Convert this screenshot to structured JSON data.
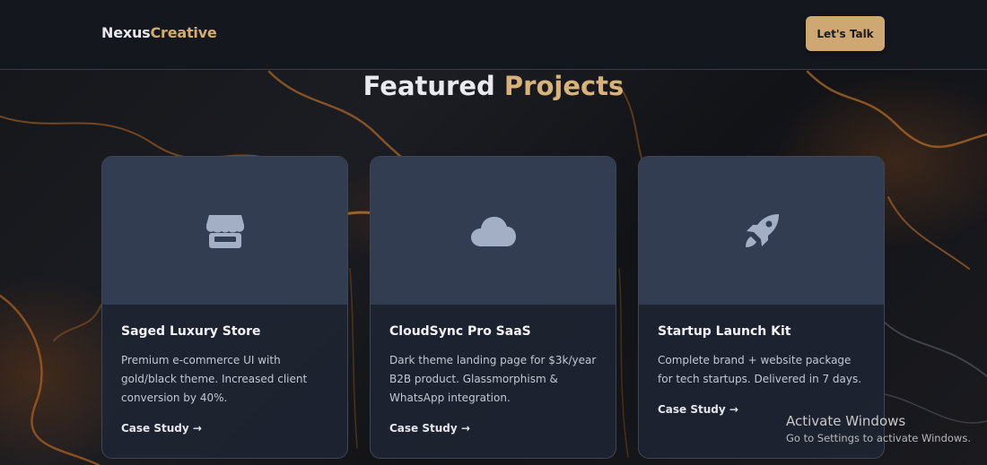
{
  "header": {
    "logo_part1": "Nexus",
    "logo_part2": "Creative",
    "cta_label": "Let's Talk"
  },
  "section": {
    "title_part1": "Featured",
    "title_part2": "Projects"
  },
  "projects": [
    {
      "icon": "store-icon",
      "title": "Saged Luxury Store",
      "description": "Premium e-commerce UI with gold/black theme. Increased client conversion by 40%.",
      "link": "Case Study →"
    },
    {
      "icon": "cloud-icon",
      "title": "CloudSync Pro SaaS",
      "description": "Dark theme landing page for $3k/year B2B product. Glassmorphism & WhatsApp integration.",
      "link": "Case Study →"
    },
    {
      "icon": "rocket-icon",
      "title": "Startup Launch Kit",
      "description": "Complete brand + website package for tech startups. Delivered in 7 days.",
      "link": "Case Study →"
    }
  ],
  "watermark": {
    "line1": "Activate Windows",
    "line2": "Go to Settings to activate Windows."
  },
  "colors": {
    "accent": "#d2ad6f",
    "button": "#cfa772",
    "card_top": "#333d52",
    "header_bg": "#15171f"
  }
}
